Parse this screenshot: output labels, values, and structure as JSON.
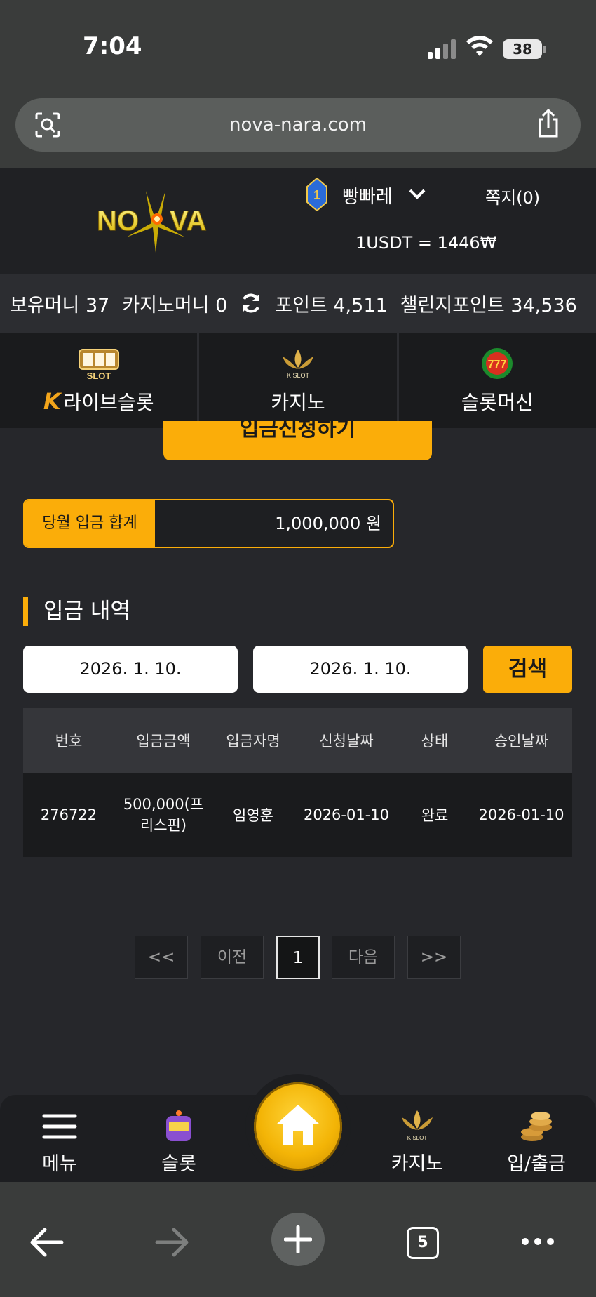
{
  "status": {
    "time": "7:04",
    "battery": "38"
  },
  "browser": {
    "url": "nova-nara.com",
    "tab_count": "5"
  },
  "header": {
    "logo_text": "NOVA",
    "username": "빵빠레",
    "level": "1",
    "messages": "쪽지(0)",
    "rate": "1USDT = 1446₩"
  },
  "balances": {
    "holding": "보유머니 37",
    "casino_money": "카지노머니 0",
    "points": "포인트 4,511",
    "challenge_points": "챌린지포인트 34,536"
  },
  "categories": [
    {
      "label": "라이브슬롯",
      "icon": "live-slot-icon"
    },
    {
      "label": "카지노",
      "icon": "kslot-casino-icon"
    },
    {
      "label": "슬롯머신",
      "icon": "slot-777-icon"
    }
  ],
  "deposit": {
    "apply_label": "입금신청하기",
    "month_total_label": "당월 입금 합계",
    "month_total_value": "1,000,000 원",
    "history_title": "입금 내역",
    "date_from": "2026. 1. 10.",
    "date_to": "2026. 1. 10.",
    "search_label": "검색"
  },
  "table": {
    "headers": [
      "번호",
      "입금금액",
      "입금자명",
      "신청날짜",
      "상태",
      "승인날짜"
    ],
    "rows": [
      [
        "276722",
        "500,000(프리스핀)",
        "임영훈",
        "2026-01-10",
        "완료",
        "2026-01-10"
      ]
    ]
  },
  "pagination": {
    "first": "<<",
    "prev": "이전",
    "current": "1",
    "next": "다음",
    "last": ">>"
  },
  "bottom_nav": [
    {
      "label": "메뉴",
      "icon": "hamburger-icon"
    },
    {
      "label": "슬롯",
      "icon": "slot-machine-icon"
    },
    {
      "label": "",
      "icon": "home-icon"
    },
    {
      "label": "카지노",
      "icon": "kslot-casino-icon"
    },
    {
      "label": "입/출금",
      "icon": "coins-icon"
    }
  ],
  "colors": {
    "accent": "#fbad09",
    "bg": "#26272b",
    "header_bg": "#202124"
  }
}
